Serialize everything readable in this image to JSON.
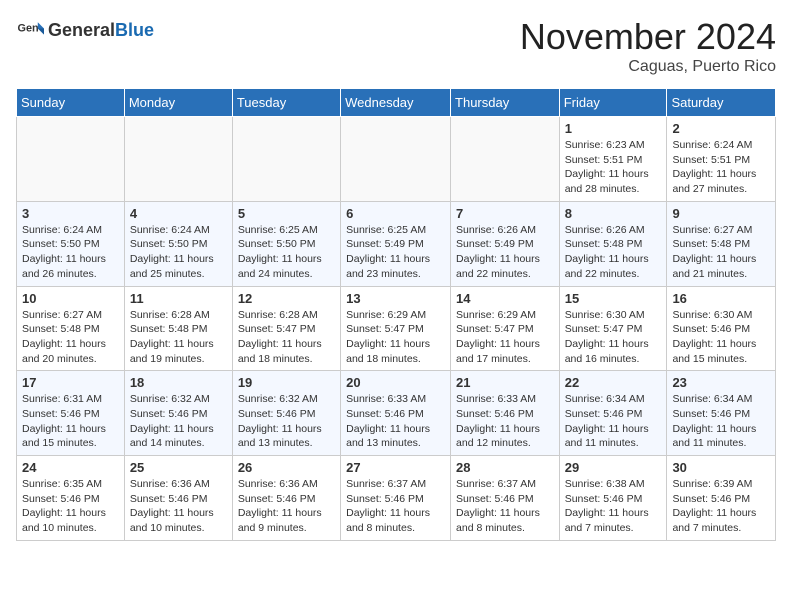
{
  "header": {
    "logo_general": "General",
    "logo_blue": "Blue",
    "month_title": "November 2024",
    "location": "Caguas, Puerto Rico"
  },
  "days_of_week": [
    "Sunday",
    "Monday",
    "Tuesday",
    "Wednesday",
    "Thursday",
    "Friday",
    "Saturday"
  ],
  "weeks": [
    [
      {
        "day": "",
        "info": ""
      },
      {
        "day": "",
        "info": ""
      },
      {
        "day": "",
        "info": ""
      },
      {
        "day": "",
        "info": ""
      },
      {
        "day": "",
        "info": ""
      },
      {
        "day": "1",
        "info": "Sunrise: 6:23 AM\nSunset: 5:51 PM\nDaylight: 11 hours and 28 minutes."
      },
      {
        "day": "2",
        "info": "Sunrise: 6:24 AM\nSunset: 5:51 PM\nDaylight: 11 hours and 27 minutes."
      }
    ],
    [
      {
        "day": "3",
        "info": "Sunrise: 6:24 AM\nSunset: 5:50 PM\nDaylight: 11 hours and 26 minutes."
      },
      {
        "day": "4",
        "info": "Sunrise: 6:24 AM\nSunset: 5:50 PM\nDaylight: 11 hours and 25 minutes."
      },
      {
        "day": "5",
        "info": "Sunrise: 6:25 AM\nSunset: 5:50 PM\nDaylight: 11 hours and 24 minutes."
      },
      {
        "day": "6",
        "info": "Sunrise: 6:25 AM\nSunset: 5:49 PM\nDaylight: 11 hours and 23 minutes."
      },
      {
        "day": "7",
        "info": "Sunrise: 6:26 AM\nSunset: 5:49 PM\nDaylight: 11 hours and 22 minutes."
      },
      {
        "day": "8",
        "info": "Sunrise: 6:26 AM\nSunset: 5:48 PM\nDaylight: 11 hours and 22 minutes."
      },
      {
        "day": "9",
        "info": "Sunrise: 6:27 AM\nSunset: 5:48 PM\nDaylight: 11 hours and 21 minutes."
      }
    ],
    [
      {
        "day": "10",
        "info": "Sunrise: 6:27 AM\nSunset: 5:48 PM\nDaylight: 11 hours and 20 minutes."
      },
      {
        "day": "11",
        "info": "Sunrise: 6:28 AM\nSunset: 5:48 PM\nDaylight: 11 hours and 19 minutes."
      },
      {
        "day": "12",
        "info": "Sunrise: 6:28 AM\nSunset: 5:47 PM\nDaylight: 11 hours and 18 minutes."
      },
      {
        "day": "13",
        "info": "Sunrise: 6:29 AM\nSunset: 5:47 PM\nDaylight: 11 hours and 18 minutes."
      },
      {
        "day": "14",
        "info": "Sunrise: 6:29 AM\nSunset: 5:47 PM\nDaylight: 11 hours and 17 minutes."
      },
      {
        "day": "15",
        "info": "Sunrise: 6:30 AM\nSunset: 5:47 PM\nDaylight: 11 hours and 16 minutes."
      },
      {
        "day": "16",
        "info": "Sunrise: 6:30 AM\nSunset: 5:46 PM\nDaylight: 11 hours and 15 minutes."
      }
    ],
    [
      {
        "day": "17",
        "info": "Sunrise: 6:31 AM\nSunset: 5:46 PM\nDaylight: 11 hours and 15 minutes."
      },
      {
        "day": "18",
        "info": "Sunrise: 6:32 AM\nSunset: 5:46 PM\nDaylight: 11 hours and 14 minutes."
      },
      {
        "day": "19",
        "info": "Sunrise: 6:32 AM\nSunset: 5:46 PM\nDaylight: 11 hours and 13 minutes."
      },
      {
        "day": "20",
        "info": "Sunrise: 6:33 AM\nSunset: 5:46 PM\nDaylight: 11 hours and 13 minutes."
      },
      {
        "day": "21",
        "info": "Sunrise: 6:33 AM\nSunset: 5:46 PM\nDaylight: 11 hours and 12 minutes."
      },
      {
        "day": "22",
        "info": "Sunrise: 6:34 AM\nSunset: 5:46 PM\nDaylight: 11 hours and 11 minutes."
      },
      {
        "day": "23",
        "info": "Sunrise: 6:34 AM\nSunset: 5:46 PM\nDaylight: 11 hours and 11 minutes."
      }
    ],
    [
      {
        "day": "24",
        "info": "Sunrise: 6:35 AM\nSunset: 5:46 PM\nDaylight: 11 hours and 10 minutes."
      },
      {
        "day": "25",
        "info": "Sunrise: 6:36 AM\nSunset: 5:46 PM\nDaylight: 11 hours and 10 minutes."
      },
      {
        "day": "26",
        "info": "Sunrise: 6:36 AM\nSunset: 5:46 PM\nDaylight: 11 hours and 9 minutes."
      },
      {
        "day": "27",
        "info": "Sunrise: 6:37 AM\nSunset: 5:46 PM\nDaylight: 11 hours and 8 minutes."
      },
      {
        "day": "28",
        "info": "Sunrise: 6:37 AM\nSunset: 5:46 PM\nDaylight: 11 hours and 8 minutes."
      },
      {
        "day": "29",
        "info": "Sunrise: 6:38 AM\nSunset: 5:46 PM\nDaylight: 11 hours and 7 minutes."
      },
      {
        "day": "30",
        "info": "Sunrise: 6:39 AM\nSunset: 5:46 PM\nDaylight: 11 hours and 7 minutes."
      }
    ]
  ]
}
